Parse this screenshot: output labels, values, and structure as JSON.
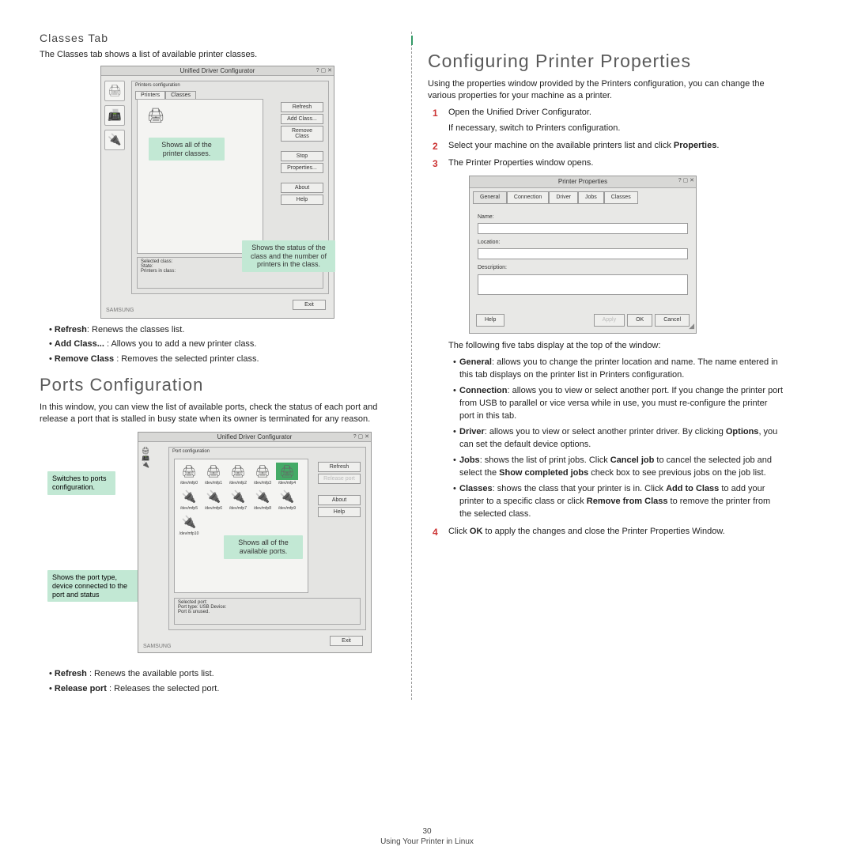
{
  "left": {
    "classes_heading": "Classes Tab",
    "classes_intro": "The Classes tab shows a list of available printer classes.",
    "ss1": {
      "title": "Unified Driver Configurator",
      "tab_printers": "Printers",
      "tab_classes": "Classes",
      "grp_label": "Printers configuration",
      "btn_refresh": "Refresh",
      "btn_addclass": "Add Class...",
      "btn_removeclass": "Remove Class",
      "btn_stop": "Stop",
      "btn_properties": "Properties...",
      "btn_about": "About",
      "btn_help": "Help",
      "sel_label": "Selected class:",
      "sel_state": "State:",
      "sel_pic": "Printers in class:",
      "logo": "SAMSUNG",
      "exit": "Exit",
      "callout1": "Shows all of the printer classes.",
      "callout2": "Shows the status of the class and the number of printers in the class."
    },
    "classes_bullets": {
      "b1_label": "Refresh",
      "b1_text": ": Renews the classes list.",
      "b2_label": "Add Class...",
      "b2_text": " : Allows you to add a new printer class.",
      "b3_label": "Remove Class",
      "b3_text": " : Removes the selected printer class."
    },
    "ports_heading": "Ports Configuration",
    "ports_intro": "In this window, you can view the list of available ports, check the status of each port and release a port that is stalled in busy state when its owner is terminated for any reason.",
    "ss2": {
      "title": "Unified Driver Configurator",
      "grp_label": "Port configuration",
      "btn_refresh": "Refresh",
      "btn_release": "Release port",
      "btn_about": "About",
      "btn_help": "Help",
      "port_prefix": "/dev/mfp",
      "sel_label": "Selected port:",
      "sel_type": "Port type: USB  Device:",
      "sel_state": "Port is unused.",
      "logo": "SAMSUNG",
      "exit": "Exit",
      "callout1": "Switches to ports configuration.",
      "callout2": "Shows all of the available ports.",
      "callout3": "Shows the port type, device connected to the port and status"
    },
    "ports_bullets": {
      "b1_label": "Refresh",
      "b1_text": " : Renews the available ports list.",
      "b2_label": "Release port",
      "b2_text": " : Releases the selected port."
    }
  },
  "right": {
    "heading": "Configuring Printer Properties",
    "intro": "Using the properties window provided by the Printers configuration, you can change the various properties for your machine as a printer.",
    "step1a": "Open the Unified Driver Configurator.",
    "step1b": "If necessary, switch to Printers configuration.",
    "step2a": "Select your machine on the available printers list and click ",
    "step2b": "Properties",
    "step2c": ".",
    "step3": "The Printer Properties window opens.",
    "ss3": {
      "title": "Printer Properties",
      "tab_general": "General",
      "tab_connection": "Connection",
      "tab_driver": "Driver",
      "tab_jobs": "Jobs",
      "tab_classes": "Classes",
      "lbl_name": "Name:",
      "lbl_location": "Location:",
      "lbl_description": "Description:",
      "btn_help": "Help",
      "btn_apply": "Apply",
      "btn_ok": "OK",
      "btn_cancel": "Cancel"
    },
    "tabs_intro": "The following five tabs display at the top of the window:",
    "gen_label": "General",
    "gen_text": ": allows you to change the printer location and name. The name entered in this tab displays on the printer list in Printers configuration.",
    "con_label": "Connection",
    "con_text": ": allows you to view or select another port. If you change the printer port from USB to parallel or vice versa while in use, you must re-configure the printer port in this tab.",
    "drv_label": "Driver",
    "drv_text1": ": allows you to view or select another printer driver. By clicking ",
    "drv_opt": "Options",
    "drv_text2": ", you can set the default device options.",
    "jobs_label": "Jobs",
    "jobs_text1": ": shows the list of print jobs. Click ",
    "jobs_cancel": "Cancel job",
    "jobs_text2": " to cancel the selected job and select the ",
    "jobs_show": "Show completed jobs",
    "jobs_text3": " check box to see previous jobs on the job list.",
    "cls_label": "Classes",
    "cls_text1": ": shows the class that your printer is in. Click ",
    "cls_add": "Add to Class",
    "cls_text2": " to add your printer to a specific class or click ",
    "cls_rem": "Remove from Class",
    "cls_text3": " to remove the printer from the selected class.",
    "step4a": "Click ",
    "step4ok": "OK",
    "step4b": " to apply the changes and close the Printer Properties Window."
  },
  "footer": {
    "page": "30",
    "chapter": "Using Your Printer in Linux"
  }
}
